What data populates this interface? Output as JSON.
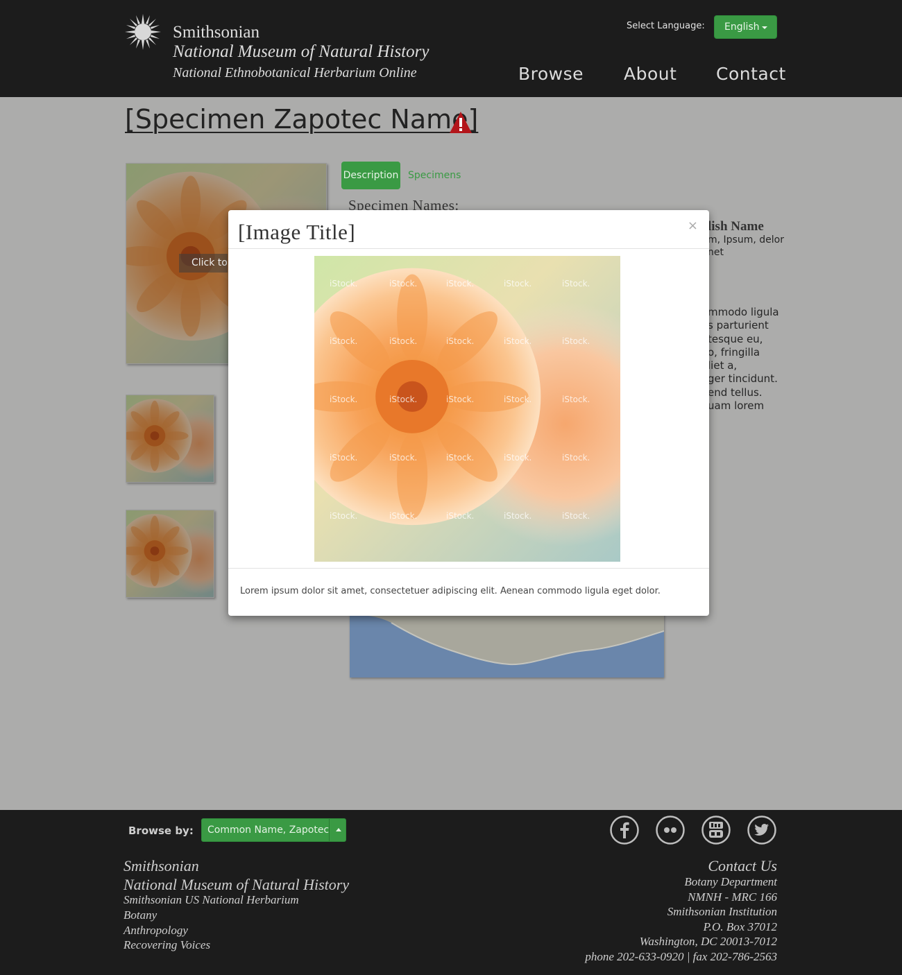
{
  "header": {
    "brand_line1": "Smithsonian",
    "brand_line2": "National Museum of Natural History",
    "brand_line3": "National Ethnobotanical Herbarium Online",
    "language_label": "Select Language:",
    "language_value": "English",
    "nav": [
      "Browse",
      "About",
      "Contact"
    ]
  },
  "page": {
    "title": "[Specimen Zapotec Name]",
    "main_image_overlay": "Click to",
    "tabs": [
      "Description",
      "Specimens"
    ],
    "specimen_names_heading": "Specimen Names:",
    "right_heading": "lish Name",
    "right_names_lines": [
      "m, Ipsum, delor",
      "net"
    ],
    "right_body_lines": [
      "mmodo ligula",
      "s parturient",
      "tesque eu,",
      "o, fringilla",
      "liet a,",
      "ger tincidunt.",
      "end tellus.",
      "uam lorem"
    ]
  },
  "modal": {
    "title": "[Image Title]",
    "close": "×",
    "watermark": "iStock.",
    "caption": "Lorem ipsum dolor sit amet, consectetuer adipiscing elit. Aenean commodo ligula eget dolor."
  },
  "footer": {
    "browse_label": "Browse by:",
    "browse_value": "Common Name, Zapotec",
    "social_icons": [
      "facebook-icon",
      "flickr-icon",
      "youtube-icon",
      "twitter-icon"
    ],
    "left_lines": [
      "Smithsonian",
      "National Museum of Natural History",
      "Smithsonian US National Herbarium",
      "Botany",
      "Anthropology",
      "Recovering Voices"
    ],
    "right_lines": [
      "Contact Us",
      "Botany Department",
      "NMNH - MRC 166",
      "Smithsonian Institution",
      "P.O. Box 37012",
      "Washington, DC 20013-7012",
      "phone 202-633-0920 | fax 202-786-2563"
    ]
  },
  "colors": {
    "header_bg": "#1c1c1c",
    "page_bg": "#acacab",
    "accent_green": "#3a9a44",
    "warning_red": "#b3161b"
  }
}
